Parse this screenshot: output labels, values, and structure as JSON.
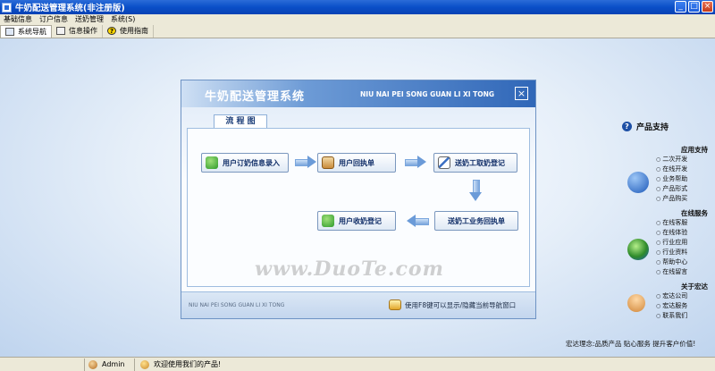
{
  "window": {
    "title": "牛奶配送管理系统(非注册版)",
    "buttons": [
      "_",
      "□",
      "×"
    ]
  },
  "menu": [
    "基础信息",
    "订户信息",
    "送奶管理",
    "系统(S)"
  ],
  "toolbar": [
    {
      "label": "系统导航",
      "icon": "window-icon",
      "active": true
    },
    {
      "label": "信息操作",
      "icon": "document-icon",
      "active": false
    },
    {
      "label": "使用指南",
      "icon": "help-icon",
      "active": false
    }
  ],
  "dialog": {
    "title": "牛奶配送管理系统",
    "subtitle": "NIU NAI PEI SONG GUAN LI XI TONG",
    "close": "×",
    "tab": "流 程 图",
    "flow": {
      "step1": "用户订奶信息录入",
      "step2": "用户回执单",
      "step3": "送奶工取奶登记",
      "step4": "送奶工业务回执单",
      "step5": "用户收奶登记"
    },
    "watermark": "www.DuoTe.com",
    "footer_pinyin": "NIU NAI PEI SONG GUAN LI XI TONG",
    "footer_hint": "使用F8键可以显示/隐藏当前导航窗口"
  },
  "support": {
    "title": "产品支持",
    "sections": [
      {
        "title": "应用支持",
        "items": [
          "二次开发",
          "在线开发",
          "业务帮助",
          "产品形式",
          "产品购买"
        ]
      },
      {
        "title": "在线服务",
        "items": [
          "在线客服",
          "在线体验",
          "行业应用",
          "行业资料",
          "帮助中心",
          "在线留言"
        ]
      },
      {
        "title": "关于宏达",
        "items": [
          "宏达公司",
          "宏达服务",
          "联系我们"
        ]
      }
    ],
    "slogan": "宏达理念:品质产品 贴心服务 提升客户价值!"
  },
  "status": {
    "user": "Admin",
    "welcome": "欢迎使用我们的产品!"
  }
}
